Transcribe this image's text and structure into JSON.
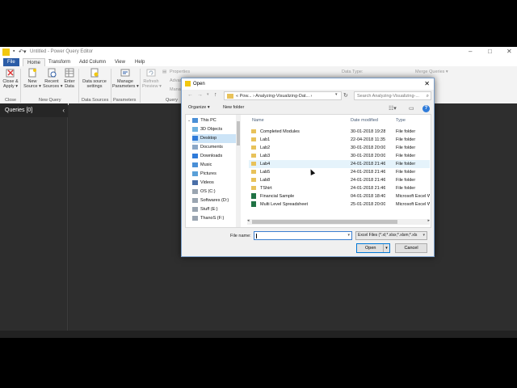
{
  "window": {
    "title": "Untitled - Power Query Editor",
    "logo": "Power BI logo",
    "controls": [
      "–",
      "□",
      "✕"
    ]
  },
  "tabs": [
    {
      "label": "File"
    },
    {
      "label": "Home"
    },
    {
      "label": "Transform"
    },
    {
      "label": "Add Column"
    },
    {
      "label": "View"
    },
    {
      "label": "Help"
    }
  ],
  "ribbon": {
    "close_apply": "Close &\nApply ▾",
    "new_source": "New\nSource ▾",
    "recent_sources": "Recent\nSources ▾",
    "enter_data": "Enter\nData",
    "data_source_settings": "Data source\nsettings",
    "manage_parameters": "Manage\nParameters ▾",
    "refresh_preview": "Refresh\nPreview ▾",
    "properties": "Properties",
    "advanced_editor_partial": "Advan",
    "manage_partial": "Mana",
    "data_type": "Data Type:",
    "merge_queries": "Merge Queries ▾",
    "groups": {
      "close": "Close",
      "new_query": "New Query",
      "data_sources": "Data Sources",
      "parameters": "Parameters",
      "query": "Query"
    }
  },
  "queries_pane": {
    "header": "Queries [0]",
    "collapse_glyph": "‹"
  },
  "dialog": {
    "title": "Open",
    "close_glyph": "✕",
    "path": "« Pow... › Analyzing-Visualizing-Dat... ›",
    "search_placeholder": "Search Analyzing-Visualizing-...",
    "organize": "Organize ▾",
    "new_folder": "New folder",
    "help": "?",
    "nav_tree": [
      {
        "label": "This PC",
        "icon": "computer-icon",
        "selected": false
      },
      {
        "label": "3D Objects",
        "icon": "cube-icon",
        "selected": false
      },
      {
        "label": "Desktop",
        "icon": "desktop-icon",
        "selected": true
      },
      {
        "label": "Documents",
        "icon": "documents-icon",
        "selected": false
      },
      {
        "label": "Downloads",
        "icon": "download-icon",
        "selected": false
      },
      {
        "label": "Music",
        "icon": "music-icon",
        "selected": false
      },
      {
        "label": "Pictures",
        "icon": "pictures-icon",
        "selected": false
      },
      {
        "label": "Videos",
        "icon": "videos-icon",
        "selected": false
      },
      {
        "label": "OS (C:)",
        "icon": "drive-icon",
        "selected": false
      },
      {
        "label": "Softwares (D:)",
        "icon": "drive-icon",
        "selected": false
      },
      {
        "label": "Stuff (E:)",
        "icon": "drive-icon",
        "selected": false
      },
      {
        "label": "ThanoS (F:)",
        "icon": "drive-icon",
        "selected": false
      }
    ],
    "columns": {
      "name": "Name",
      "date_modified": "Date modified",
      "type": "Type"
    },
    "files": [
      {
        "name": "Completed Modules",
        "date": "30-01-2018 19:28",
        "type": "File folder",
        "kind": "folder",
        "hover": false
      },
      {
        "name": "Lab1",
        "date": "22-04-2018 11:35",
        "type": "File folder",
        "kind": "folder",
        "hover": false
      },
      {
        "name": "Lab2",
        "date": "30-01-2018 20:00",
        "type": "File folder",
        "kind": "folder",
        "hover": false
      },
      {
        "name": "Lab3",
        "date": "30-01-2018 20:00",
        "type": "File folder",
        "kind": "folder",
        "hover": false
      },
      {
        "name": "Lab4",
        "date": "24-01-2018 21:46",
        "type": "File folder",
        "kind": "folder",
        "hover": true
      },
      {
        "name": "Lab5",
        "date": "24-01-2018 21:46",
        "type": "File folder",
        "kind": "folder",
        "hover": false
      },
      {
        "name": "Lab8",
        "date": "24-01-2018 21:46",
        "type": "File folder",
        "kind": "folder",
        "hover": false
      },
      {
        "name": "TShirt",
        "date": "24-01-2018 21:46",
        "type": "File folder",
        "kind": "folder",
        "hover": false
      },
      {
        "name": "Financial Sample",
        "date": "04-01-2018 18:40",
        "type": "Microsoft Excel W...",
        "kind": "excel",
        "hover": false
      },
      {
        "name": "Multi Level Spreadsheet",
        "date": "25-01-2018 20:00",
        "type": "Microsoft Excel W...",
        "kind": "excel",
        "hover": false
      }
    ],
    "file_name_label": "File name:",
    "file_name_value": "",
    "file_type_filter": "Excel Files (*.xl;*.xlsx;*.xlsm;*.xls",
    "open_button": "Open",
    "cancel_button": "Cancel"
  },
  "colors": {
    "accent": "#2c5da7",
    "app_background": "#2b2b2b",
    "selection": "#cce4f7",
    "powerbi_yellow": "#f2c811",
    "folder": "#e8c25a",
    "excel_green": "#1f7244"
  }
}
